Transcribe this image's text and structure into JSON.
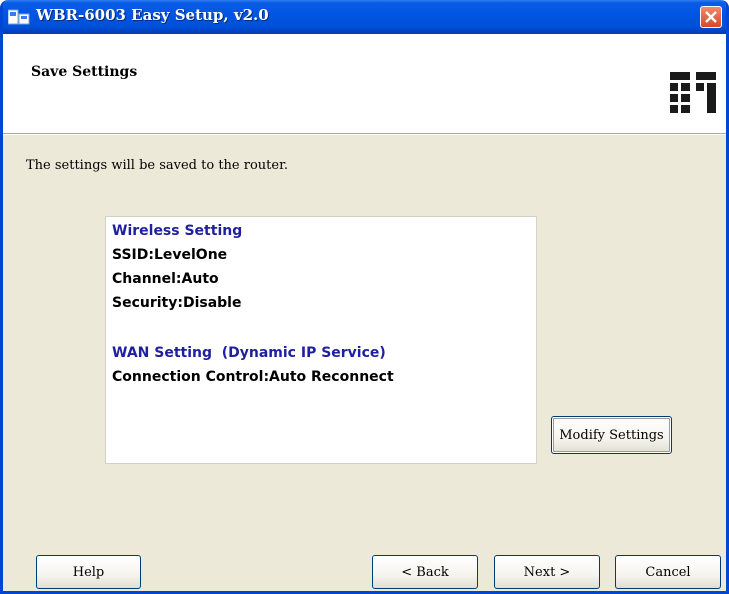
{
  "window": {
    "title": "WBR-6003 Easy Setup, v2.0"
  },
  "header": {
    "title": "Save Settings",
    "logo_icon": "levelone-logo"
  },
  "intro_text": "The settings will be saved to the router.",
  "summary": {
    "wireless_heading": "Wireless Setting",
    "ssid": "SSID:LevelOne",
    "channel": "Channel:Auto",
    "security": "Security:Disable",
    "wan_heading": "WAN Setting  (Dynamic IP Service)",
    "connection_control": "Connection Control:Auto Reconnect"
  },
  "buttons": {
    "modify": "Modify Settings",
    "help": "Help",
    "back": "< Back",
    "next": "Next >",
    "cancel": "Cancel"
  },
  "colors": {
    "titlebar": "#0055e3",
    "heading_text": "#1f1fa0",
    "close_button": "#d8472a"
  }
}
